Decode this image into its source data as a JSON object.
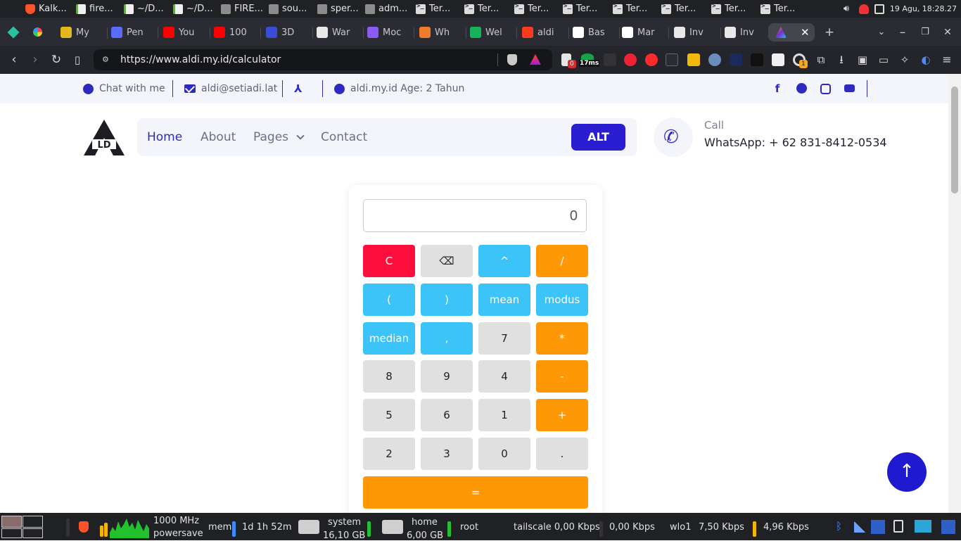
{
  "system_panel": {
    "windows": [
      {
        "label": "Kalk...",
        "icon": "brave-browser-icon"
      },
      {
        "label": "fire...",
        "icon": "text-editor-icon"
      },
      {
        "label": "~/D...",
        "icon": "text-editor-icon"
      },
      {
        "label": "~/D...",
        "icon": "text-editor-icon"
      },
      {
        "label": "FIRE...",
        "icon": "folder-icon"
      },
      {
        "label": "sou...",
        "icon": "folder-icon"
      },
      {
        "label": "sper...",
        "icon": "folder-icon"
      },
      {
        "label": "adm...",
        "icon": "folder-icon"
      },
      {
        "label": "Ter...",
        "icon": "terminal-icon"
      },
      {
        "label": "Ter...",
        "icon": "terminal-icon"
      },
      {
        "label": "Ter...",
        "icon": "terminal-icon"
      },
      {
        "label": "Ter...",
        "icon": "terminal-icon"
      },
      {
        "label": "Ter...",
        "icon": "terminal-icon"
      },
      {
        "label": "Ter...",
        "icon": "terminal-icon"
      },
      {
        "label": "Ter...",
        "icon": "terminal-icon"
      },
      {
        "label": "Ter...",
        "icon": "terminal-icon"
      }
    ],
    "clock": "19 Agu, 18:28.27"
  },
  "tabs": [
    {
      "label": "My",
      "color": "#e5b71d"
    },
    {
      "label": "Pen",
      "color": "#5a6cff"
    },
    {
      "label": "You",
      "color": "#ff0000"
    },
    {
      "label": "100",
      "color": "#ff0000"
    },
    {
      "label": "3D",
      "color": "#3b4bd6"
    },
    {
      "label": "War",
      "color": "#e8e8e8"
    },
    {
      "label": "Moc",
      "color": "#8a5cf6"
    },
    {
      "label": "Wh",
      "color": "#f07b2a"
    },
    {
      "label": "Wel",
      "color": "#17b35b"
    },
    {
      "label": "aldi",
      "color": "#ff3b1f"
    },
    {
      "label": "Bas",
      "color": "#ffffff"
    },
    {
      "label": "Mar",
      "color": "#ffffff"
    },
    {
      "label": "Inv",
      "color": "#e8e8e8"
    },
    {
      "label": "Inv",
      "color": "#e8e8e8"
    }
  ],
  "browser": {
    "url": "https://www.aldi.my.id/calculator",
    "ext_badges": {
      "red": "0",
      "ping": "17ms",
      "orange": "1"
    }
  },
  "site": {
    "topbar": {
      "chat": "Chat with me",
      "email": "aldi@setiadi.lat",
      "age": "aldi.my.id Age: 2 Tahun"
    },
    "nav": {
      "home": "Home",
      "about": "About",
      "pages": "Pages",
      "contact": "Contact",
      "alt": "ALT"
    },
    "call": {
      "label": "Call",
      "number": "WhatsApp: + 62 831-8412-0534"
    }
  },
  "calculator": {
    "display": "0",
    "keys": [
      [
        "C",
        "⌫",
        "^",
        "/"
      ],
      [
        "(",
        ")",
        "mean",
        "modus"
      ],
      [
        "median",
        ",",
        "7",
        "*"
      ],
      [
        "8",
        "9",
        "4",
        "-"
      ],
      [
        "5",
        "6",
        "1",
        "+"
      ],
      [
        "2",
        "3",
        "0",
        "."
      ]
    ],
    "key_styles": [
      [
        "red",
        "gray",
        "blue",
        "orange"
      ],
      [
        "blue",
        "blue",
        "blue",
        "blue"
      ],
      [
        "blue",
        "blue",
        "gray",
        "orange"
      ],
      [
        "gray",
        "gray",
        "gray",
        "orange"
      ],
      [
        "gray",
        "gray",
        "gray",
        "orange"
      ],
      [
        "gray",
        "gray",
        "gray",
        "gray"
      ]
    ],
    "equals": "="
  },
  "bottom_panel": {
    "cpu_freq": "1000 MHz",
    "cpu_governor": "powersave",
    "mem_label": "mem",
    "uptime": "1d 1h 52m",
    "system_label": "system",
    "system_size": "16,10 GB",
    "home_label": "home",
    "home_size": "6,00 GB",
    "root_label": "root",
    "tailscale": "tailscale 0,00 Kbps",
    "tailscale_up": "0,00 Kbps",
    "wlo1": "wlo1",
    "wlo1_down": "7,50 Kbps",
    "wlo1_up": "4,96 Kbps"
  },
  "colors": {
    "accent": "#2e2ac0",
    "key_red": "#fd0f3d",
    "key_blue": "#3cc3f7",
    "key_orange": "#ff9806",
    "key_gray": "#e0e0e0"
  }
}
